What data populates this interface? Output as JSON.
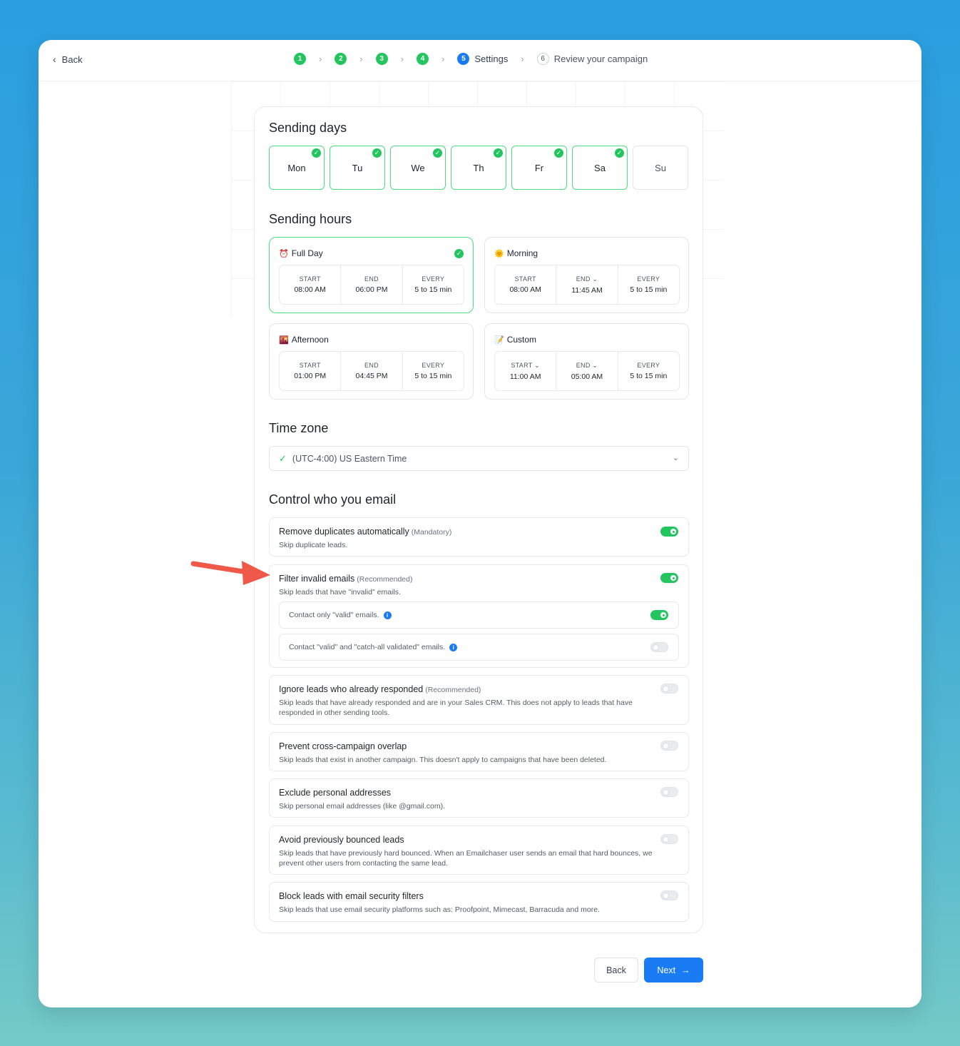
{
  "nav": {
    "back_label": "Back"
  },
  "stepper": {
    "steps": [
      {
        "num": "1",
        "state": "done"
      },
      {
        "num": "2",
        "state": "done"
      },
      {
        "num": "3",
        "state": "done"
      },
      {
        "num": "4",
        "state": "done"
      },
      {
        "num": "5",
        "state": "active",
        "label": "Settings"
      },
      {
        "num": "6",
        "state": "todo",
        "label": "Review your campaign"
      }
    ],
    "sep_glyph": "›"
  },
  "sending_days": {
    "title": "Sending days",
    "days": [
      {
        "label": "Mon",
        "selected": true
      },
      {
        "label": "Tu",
        "selected": true
      },
      {
        "label": "We",
        "selected": true
      },
      {
        "label": "Th",
        "selected": true
      },
      {
        "label": "Fr",
        "selected": true
      },
      {
        "label": "Sa",
        "selected": true
      },
      {
        "label": "Su",
        "selected": false
      }
    ]
  },
  "sending_hours": {
    "title": "Sending hours",
    "cards": [
      {
        "name": "Full Day",
        "icon": "alarm-clock-icon",
        "emoji": "⏰",
        "selected": true,
        "start_label": "START",
        "start": "08:00 AM",
        "end_label": "END",
        "end": "06:00 PM",
        "every_label": "EVERY",
        "every": "5 to 15 min"
      },
      {
        "name": "Morning",
        "icon": "sun-icon",
        "emoji": "🌞",
        "selected": false,
        "start_label": "START",
        "start": "08:00 AM",
        "end_label": "END ⌄",
        "end": "11:45 AM",
        "every_label": "EVERY",
        "every": "5 to 15 min"
      },
      {
        "name": "Afternoon",
        "icon": "sunset-icon",
        "emoji": "🌇",
        "selected": false,
        "start_label": "START",
        "start": "01:00 PM",
        "end_label": "END",
        "end": "04:45 PM",
        "every_label": "EVERY",
        "every": "5 to 15 min"
      },
      {
        "name": "Custom",
        "icon": "memo-icon",
        "emoji": "📝",
        "selected": false,
        "start_label": "START ⌄",
        "start": "11:00 AM",
        "end_label": "END ⌄",
        "end": "05:00 AM",
        "every_label": "EVERY",
        "every": "5 to 15 min"
      }
    ]
  },
  "time_zone": {
    "title": "Time zone",
    "value": "(UTC-4:00) US Eastern Time"
  },
  "control": {
    "title": "Control who you email",
    "options": [
      {
        "title": "Remove duplicates automatically",
        "tag": "(Mandatory)",
        "desc": "Skip duplicate leads.",
        "on": true
      },
      {
        "title": "Filter invalid emails",
        "tag": "(Recommended)",
        "desc": "Skip leads that have \"invalid\" emails.",
        "on": true,
        "sub": [
          {
            "text": "Contact only \"valid\" emails.",
            "on": true
          },
          {
            "text": "Contact \"valid\" and \"catch-all validated\" emails.",
            "on": false
          }
        ]
      },
      {
        "title": "Ignore leads who already responded",
        "tag": "(Recommended)",
        "desc": "Skip leads that have already responded and are in your Sales CRM. This does not apply to leads that have responded in other sending tools.",
        "on": false
      },
      {
        "title": "Prevent cross-campaign overlap",
        "tag": "",
        "desc": "Skip leads that exist in another campaign. This doesn't apply to campaigns that have been deleted.",
        "on": false
      },
      {
        "title": "Exclude personal addresses",
        "tag": "",
        "desc": "Skip personal email addresses (like @gmail.com).",
        "on": false
      },
      {
        "title": "Avoid previously bounced leads",
        "tag": "",
        "desc": "Skip leads that have previously hard bounced. When an Emailchaser user sends an email that hard bounces, we prevent other users from contacting the same lead.",
        "on": false
      },
      {
        "title": "Block leads with email security filters",
        "tag": "",
        "desc": "Skip leads that use email security platforms such as: Proofpoint, Mimecast, Barracuda and more.",
        "on": false
      }
    ]
  },
  "footer": {
    "back_label": "Back",
    "next_label": "Next"
  },
  "colors": {
    "accent": "#1a7cf5",
    "success": "#22c55e",
    "annotation_arrow": "#f0584a"
  }
}
